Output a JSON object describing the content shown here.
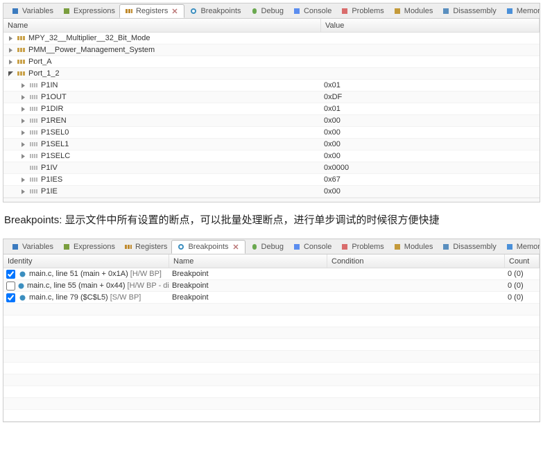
{
  "tabs": [
    {
      "label": "Variables",
      "icon": "variables-icon"
    },
    {
      "label": "Expressions",
      "icon": "expressions-icon"
    },
    {
      "label": "Registers",
      "icon": "registers-icon"
    },
    {
      "label": "Breakpoints",
      "icon": "breakpoints-icon"
    },
    {
      "label": "Debug",
      "icon": "debug-icon"
    },
    {
      "label": "Console",
      "icon": "console-icon"
    },
    {
      "label": "Problems",
      "icon": "problems-icon"
    },
    {
      "label": "Modules",
      "icon": "modules-icon"
    },
    {
      "label": "Disassembly",
      "icon": "disassembly-icon"
    },
    {
      "label": "Memory Browser",
      "icon": "memory-icon"
    }
  ],
  "panel1": {
    "activeTab": 2,
    "columns": {
      "name": "Name",
      "value": "Value"
    },
    "rows": [
      {
        "indent": 0,
        "exp": "closed",
        "icon": "group",
        "name": "MPY_32__Multiplier__32_Bit_Mode",
        "value": ""
      },
      {
        "indent": 0,
        "exp": "closed",
        "icon": "group",
        "name": "PMM__Power_Management_System",
        "value": ""
      },
      {
        "indent": 0,
        "exp": "closed",
        "icon": "group",
        "name": "Port_A",
        "value": ""
      },
      {
        "indent": 0,
        "exp": "open",
        "icon": "group",
        "name": "Port_1_2",
        "value": ""
      },
      {
        "indent": 1,
        "exp": "closed",
        "icon": "reg",
        "name": "P1IN",
        "value": "0x01"
      },
      {
        "indent": 1,
        "exp": "closed",
        "icon": "reg",
        "name": "P1OUT",
        "value": "0xDF"
      },
      {
        "indent": 1,
        "exp": "closed",
        "icon": "reg",
        "name": "P1DIR",
        "value": "0x01"
      },
      {
        "indent": 1,
        "exp": "closed",
        "icon": "reg",
        "name": "P1REN",
        "value": "0x00"
      },
      {
        "indent": 1,
        "exp": "closed",
        "icon": "reg",
        "name": "P1SEL0",
        "value": "0x00"
      },
      {
        "indent": 1,
        "exp": "closed",
        "icon": "reg",
        "name": "P1SEL1",
        "value": "0x00"
      },
      {
        "indent": 1,
        "exp": "closed",
        "icon": "reg",
        "name": "P1SELC",
        "value": "0x00"
      },
      {
        "indent": 1,
        "exp": "none",
        "icon": "reg",
        "name": "P1IV",
        "value": "0x0000"
      },
      {
        "indent": 1,
        "exp": "closed",
        "icon": "reg",
        "name": "P1IES",
        "value": "0x67"
      },
      {
        "indent": 1,
        "exp": "closed",
        "icon": "reg",
        "name": "P1IE",
        "value": "0x00"
      }
    ]
  },
  "description": "Breakpoints:  显示文件中所有设置的断点，可以批量处理断点，进行单步调试的时候很方便快捷",
  "panel2": {
    "activeTab": 3,
    "columns": {
      "identity": "Identity",
      "name": "Name",
      "condition": "Condition",
      "count": "Count"
    },
    "rows": [
      {
        "checked": true,
        "identity": "main.c, line 51 (main + 0x1A)",
        "type": "[H/W BP]",
        "name": "Breakpoint",
        "condition": "",
        "count": "0 (0)"
      },
      {
        "checked": false,
        "identity": "main.c, line 55 (main + 0x44)",
        "type": "[H/W BP - dis",
        "name": "Breakpoint",
        "condition": "",
        "count": "0 (0)"
      },
      {
        "checked": true,
        "identity": "main.c, line 79 ($C$L5)",
        "type": "[S/W BP]",
        "name": "Breakpoint",
        "condition": "",
        "count": "0 (0)"
      }
    ],
    "emptyRows": 10
  }
}
